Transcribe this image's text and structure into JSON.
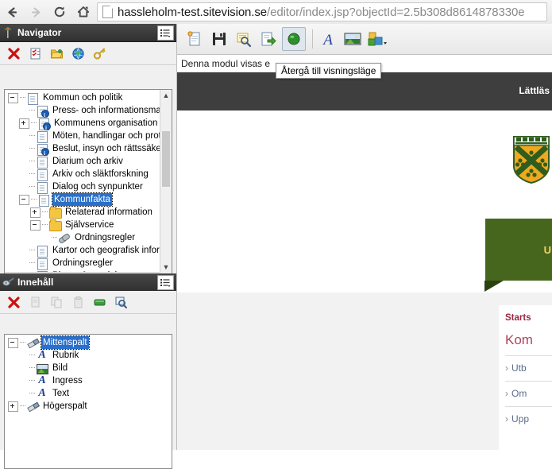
{
  "browser": {
    "back_label": "Back",
    "forward_label": "Forward",
    "reload_label": "Reload",
    "home_label": "Home",
    "url_host": "hassleholm-test.sitevision.se",
    "url_path": "/editor/index.jsp?objectId=2.5b308d8614878330e"
  },
  "navigator_panel": {
    "title": "Navigator",
    "menu_label": "Visa meny",
    "toolbar": [
      {
        "name": "delete-icon",
        "label": "Ta bort"
      },
      {
        "name": "properties-icon",
        "label": "Egenskaper"
      },
      {
        "name": "folder-icon",
        "label": "Mapp"
      },
      {
        "name": "globe-icon",
        "label": "Publicera"
      },
      {
        "name": "key-icon",
        "label": "Behörighet"
      }
    ],
    "tree": [
      {
        "label": "Kommun och politik",
        "depth": 0,
        "icon": "page",
        "expander": "minus",
        "badge": false,
        "selected": false
      },
      {
        "label": "Press- och informationsmateri",
        "depth": 1,
        "icon": "page",
        "expander": "none",
        "badge": true,
        "selected": false
      },
      {
        "label": "Kommunens organisation",
        "depth": 1,
        "icon": "page",
        "expander": "plus",
        "badge": true,
        "selected": false
      },
      {
        "label": "Möten, handlingar och protok",
        "depth": 1,
        "icon": "page",
        "expander": "none",
        "badge": false,
        "selected": false
      },
      {
        "label": "Beslut, insyn och rättssäkerhe",
        "depth": 1,
        "icon": "page",
        "expander": "none",
        "badge": true,
        "selected": false
      },
      {
        "label": "Diarium och arkiv",
        "depth": 1,
        "icon": "page",
        "expander": "none",
        "badge": false,
        "selected": false
      },
      {
        "label": "Arkiv och släktforskning",
        "depth": 1,
        "icon": "page",
        "expander": "none",
        "badge": false,
        "selected": false
      },
      {
        "label": "Dialog och synpunkter",
        "depth": 1,
        "icon": "page",
        "expander": "none",
        "badge": false,
        "selected": false
      },
      {
        "label": "Kommunfakta",
        "depth": 1,
        "icon": "page",
        "expander": "minus",
        "badge": false,
        "selected": true
      },
      {
        "label": "Relaterad information",
        "depth": 2,
        "icon": "folder",
        "expander": "plus",
        "badge": false,
        "selected": false
      },
      {
        "label": "Självservice",
        "depth": 2,
        "icon": "folder",
        "expander": "minus",
        "badge": false,
        "selected": false
      },
      {
        "label": "Ordningsregler",
        "depth": 3,
        "icon": "link",
        "expander": "none",
        "badge": false,
        "selected": false
      },
      {
        "label": "Kartor och geografisk informa",
        "depth": 1,
        "icon": "page",
        "expander": "none",
        "badge": false,
        "selected": false
      },
      {
        "label": "Ordningsregler",
        "depth": 1,
        "icon": "page",
        "expander": "none",
        "badge": false,
        "selected": false
      },
      {
        "label": "Planer & styrdokument",
        "depth": 1,
        "icon": "page",
        "expander": "none",
        "badge": false,
        "selected": false
      }
    ]
  },
  "content_panel": {
    "title": "Innehåll",
    "menu_label": "Visa meny",
    "toolbar": [
      {
        "name": "delete-icon",
        "label": "Ta bort",
        "disabled": false
      },
      {
        "name": "copy-page-icon",
        "label": "Kopiera",
        "disabled": true
      },
      {
        "name": "duplicate-icon",
        "label": "Duplicera",
        "disabled": true
      },
      {
        "name": "paste-icon",
        "label": "Klistra in",
        "disabled": true
      },
      {
        "name": "module-icon",
        "label": "Modul",
        "disabled": false
      },
      {
        "name": "preview-icon",
        "label": "Förhandsgranska",
        "disabled": false
      }
    ],
    "tree": [
      {
        "label": "Mittenspalt",
        "depth": 0,
        "icon": "brush",
        "expander": "minus",
        "selected": true
      },
      {
        "label": "Rubrik",
        "depth": 1,
        "icon": "text",
        "expander": "none",
        "selected": false
      },
      {
        "label": "Bild",
        "depth": 1,
        "icon": "image",
        "expander": "none",
        "selected": false
      },
      {
        "label": "Ingress",
        "depth": 1,
        "icon": "text",
        "expander": "none",
        "selected": false
      },
      {
        "label": "Text",
        "depth": 1,
        "icon": "text",
        "expander": "none",
        "selected": false
      },
      {
        "label": "Högerspalt",
        "depth": 0,
        "icon": "brush",
        "expander": "plus",
        "selected": false
      }
    ]
  },
  "editor": {
    "toolbar": [
      {
        "name": "new-page-icon",
        "label": "Ny sida",
        "active": false
      },
      {
        "name": "save-icon",
        "label": "Spara",
        "active": false
      },
      {
        "name": "preview-icon",
        "label": "Förhandsgranska",
        "active": false
      },
      {
        "name": "publish-icon",
        "label": "Publicera",
        "active": false
      },
      {
        "name": "view-mode-icon",
        "label": "Återgå till visningsläge",
        "active": true
      },
      {
        "name": "text-module-icon",
        "label": "Textmodul",
        "active": false
      },
      {
        "name": "image-module-icon",
        "label": "Bildmodul",
        "active": false
      },
      {
        "name": "modules-icon",
        "label": "Moduler",
        "active": false
      }
    ],
    "tooltip": "Återgå till visningsläge",
    "notice": "Denna modul visas e",
    "site": {
      "topbar_link": "Lättläs",
      "banner_text": "U",
      "crest_alt": "Hässleholms kommunvapen",
      "card": {
        "breadcrumb": "Starts",
        "title": "Kom",
        "links": [
          "Utb",
          "Om",
          "Upp"
        ],
        "chevron": "›"
      }
    }
  },
  "colors": {
    "panel_header": "#3b3b3b",
    "selection": "#2a6fc9",
    "site_topbar": "#3e3e3e",
    "green_banner": "#47661d",
    "crest_gold": "#f0a81e",
    "card_accent": "#9b2743"
  }
}
